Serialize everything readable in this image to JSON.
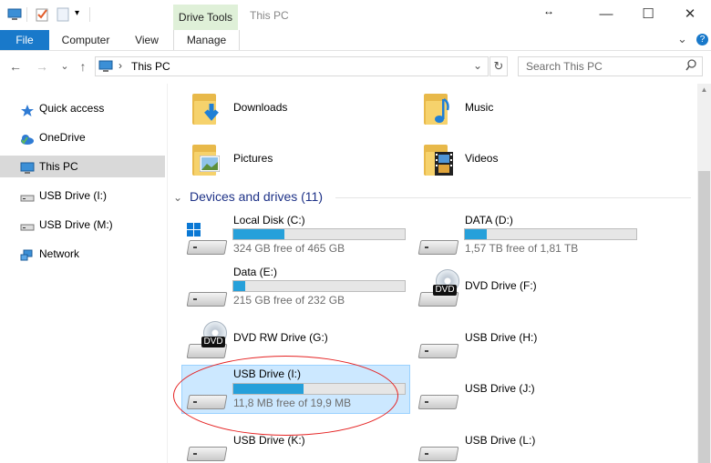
{
  "window": {
    "title": "This PC",
    "contextual_tab": "Drive Tools",
    "minimize": "—",
    "maximize": "☐",
    "close": "✕",
    "resize_glyph": "↔"
  },
  "ribbon": {
    "tabs": [
      "File",
      "Computer",
      "View",
      "Manage"
    ],
    "collapse_glyph": "⌄",
    "help_glyph": "?"
  },
  "address": {
    "back": "←",
    "forward": "→",
    "recent": "⌄",
    "up": "↑",
    "separator": "›",
    "path": "This PC",
    "dropdown": "⌄",
    "refresh": "↻"
  },
  "search": {
    "placeholder": "Search This PC",
    "icon": "search-icon"
  },
  "sidebar": {
    "items": [
      {
        "label": "Quick access",
        "icon": "star-icon"
      },
      {
        "label": "OneDrive",
        "icon": "cloud-icon"
      },
      {
        "label": "This PC",
        "icon": "computer-icon",
        "selected": true
      },
      {
        "label": "USB Drive (I:)",
        "icon": "usb-drive-icon"
      },
      {
        "label": "USB Drive (M:)",
        "icon": "usb-drive-icon"
      },
      {
        "label": "Network",
        "icon": "network-icon"
      }
    ]
  },
  "folders": [
    {
      "label": "Downloads",
      "icon": "downloads-folder-icon"
    },
    {
      "label": "Music",
      "icon": "music-folder-icon"
    },
    {
      "label": "Pictures",
      "icon": "pictures-folder-icon"
    },
    {
      "label": "Videos",
      "icon": "videos-folder-icon"
    }
  ],
  "devices_section": {
    "title": "Devices and drives (11)",
    "chevron": "⌄"
  },
  "drives": [
    {
      "label": "Local Disk (C:)",
      "free": "324 GB free of 465 GB",
      "used_fraction": 0.3,
      "icon": "windows-drive-icon"
    },
    {
      "label": "DATA (D:)",
      "free": "1,57 TB free of 1,81 TB",
      "used_fraction": 0.13,
      "icon": "hard-drive-icon"
    },
    {
      "label": "Data (E:)",
      "free": "215 GB free of 232 GB",
      "used_fraction": 0.07,
      "icon": "hard-drive-icon"
    },
    {
      "label": "DVD Drive (F:)",
      "icon": "dvd-drive-icon",
      "badge": "DVD"
    },
    {
      "label": "DVD RW Drive (G:)",
      "icon": "dvd-rw-drive-icon",
      "badge": "DVD"
    },
    {
      "label": "USB Drive (H:)",
      "icon": "usb-drive-icon"
    },
    {
      "label": "USB Drive (I:)",
      "free": "11,8 MB free of 19,9 MB",
      "used_fraction": 0.41,
      "icon": "usb-drive-icon",
      "selected": true
    },
    {
      "label": "USB Drive (J:)",
      "icon": "usb-drive-icon"
    },
    {
      "label": "USB Drive (K:)",
      "icon": "usb-drive-icon"
    },
    {
      "label": "USB Drive (L:)",
      "icon": "usb-drive-icon"
    }
  ],
  "colors": {
    "accent": "#1979ca",
    "bar_fill": "#26a0da",
    "section_header": "#1e3287",
    "selection": "#cce8ff",
    "annotation": "#e52222"
  }
}
